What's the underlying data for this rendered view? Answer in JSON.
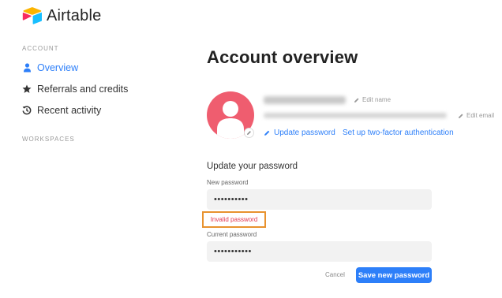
{
  "app": {
    "name": "Airtable"
  },
  "sidebar": {
    "account_heading": "ACCOUNT",
    "items": [
      {
        "label": "Overview",
        "icon": "person-icon",
        "active": true
      },
      {
        "label": "Referrals and credits",
        "icon": "star-icon",
        "active": false
      },
      {
        "label": "Recent activity",
        "icon": "history-icon",
        "active": false
      }
    ],
    "workspaces_heading": "WORKSPACES"
  },
  "main": {
    "title": "Account overview",
    "profile": {
      "edit_name_label": "Edit name",
      "edit_email_label": "Edit email",
      "update_password_link": "Update password",
      "two_factor_link": "Set up two-factor authentication"
    },
    "password_form": {
      "title": "Update your password",
      "new_password_label": "New password",
      "new_password_value": "••••••••••",
      "error_message": "Invalid password",
      "current_password_label": "Current password",
      "current_password_value": "•••••••••••",
      "cancel_label": "Cancel",
      "save_label": "Save new password"
    }
  },
  "colors": {
    "accent": "#2d7ff9",
    "avatar_bg": "#ef5d6f",
    "error_text": "#e0364f",
    "highlight_border": "#e8922e"
  }
}
